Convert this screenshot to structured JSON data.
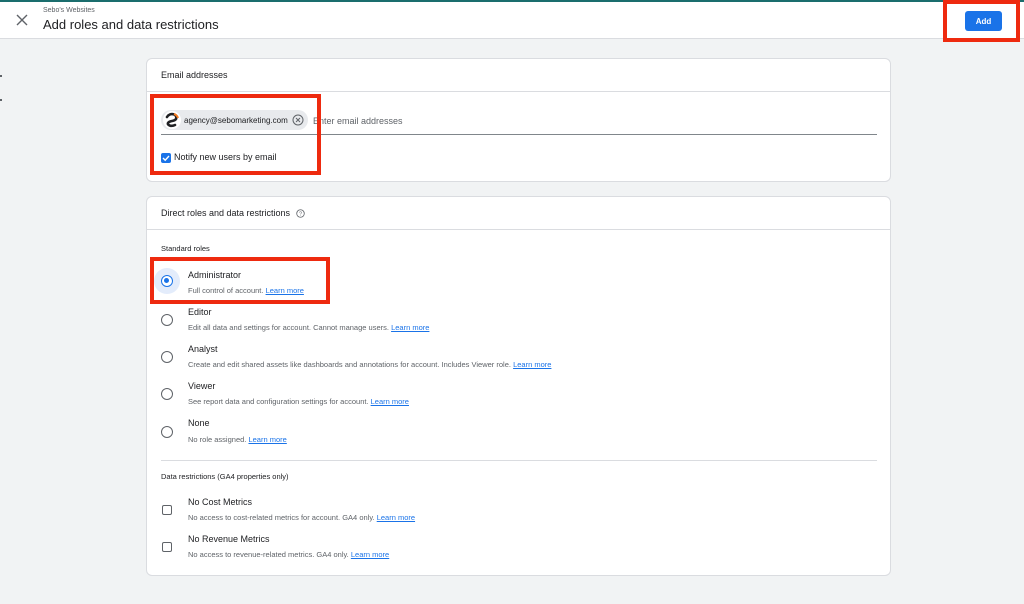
{
  "header": {
    "breadcrumb": "Sebo's Websites",
    "title": "Add roles and data restrictions",
    "add_label": "Add"
  },
  "email_card": {
    "title": "Email addresses",
    "chip_email": "agency@sebomarketing.com",
    "input_placeholder": "Enter email addresses",
    "notify_label": "Notify new users by email",
    "notify_checked": true
  },
  "roles_card": {
    "title": "Direct roles and data restrictions",
    "standard_roles_label": "Standard roles",
    "learn_more": "Learn more",
    "roles": [
      {
        "name": "Administrator",
        "desc": "Full control of account.",
        "selected": true
      },
      {
        "name": "Editor",
        "desc": "Edit all data and settings for account. Cannot manage users.",
        "selected": false
      },
      {
        "name": "Analyst",
        "desc": "Create and edit shared assets like dashboards and annotations for account. Includes Viewer role.",
        "selected": false
      },
      {
        "name": "Viewer",
        "desc": "See report data and configuration settings for account.",
        "selected": false
      },
      {
        "name": "None",
        "desc": "No role assigned.",
        "selected": false
      }
    ],
    "data_restrictions_label": "Data restrictions (GA4 properties only)",
    "restrictions": [
      {
        "name": "No Cost Metrics",
        "desc": "No access to cost-related metrics for account. GA4 only.",
        "checked": false
      },
      {
        "name": "No Revenue Metrics",
        "desc": "No access to revenue-related metrics. GA4 only.",
        "checked": false
      }
    ]
  },
  "colors": {
    "accent": "#1a73e8",
    "highlight": "#ee2a0f",
    "background": "#f1f3f4"
  }
}
